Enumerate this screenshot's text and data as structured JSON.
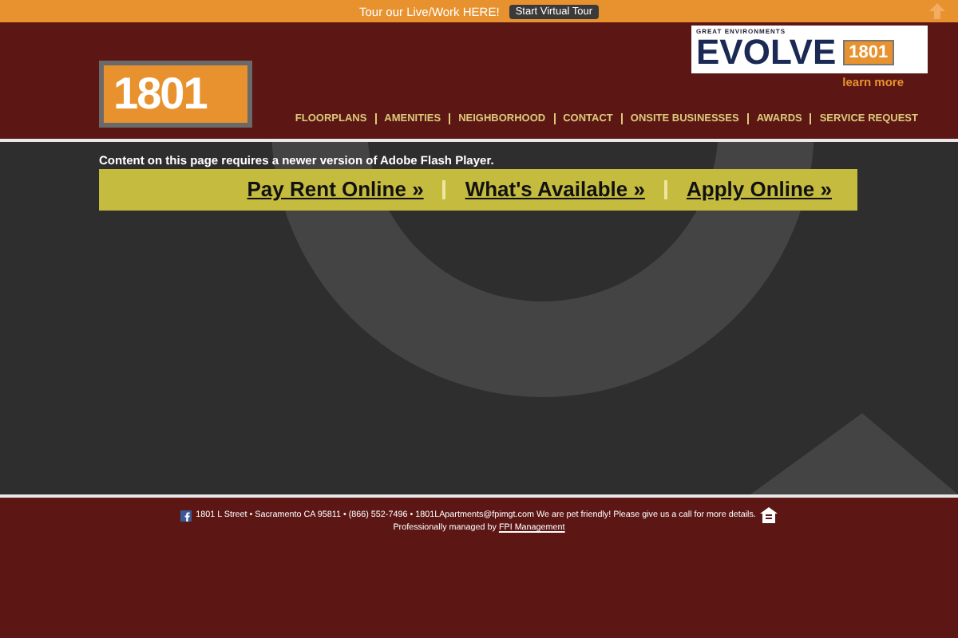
{
  "promo_bar": {
    "text": "Tour our Live/Work HERE!",
    "button": "Start Virtual Tour"
  },
  "logo": {
    "text": "1801"
  },
  "evolve_banner": {
    "tagline": "GREAT ENVIRONMENTS",
    "word": "EVOLVE",
    "badge": "1801",
    "link": "learn more"
  },
  "nav": [
    "FLOORPLANS",
    "AMENITIES",
    "NEIGHBORHOOD",
    "CONTACT",
    "ONSITE BUSINESSES",
    "AWARDS",
    "SERVICE REQUEST"
  ],
  "flash_notice": "Content on this page requires a newer version of Adobe Flash Player.",
  "action_links": [
    "Pay Rent Online »",
    "What's Available »",
    "Apply Online »"
  ],
  "footer": {
    "address": "1801 L Street • Sacramento CA 95811 • (866) 552-7496 • 1801LApartments@fpimgt.com   We are pet friendly! Please give us a call for more details.",
    "managed_prefix": "Professionally managed by ",
    "managed_link": "FPI Management"
  }
}
